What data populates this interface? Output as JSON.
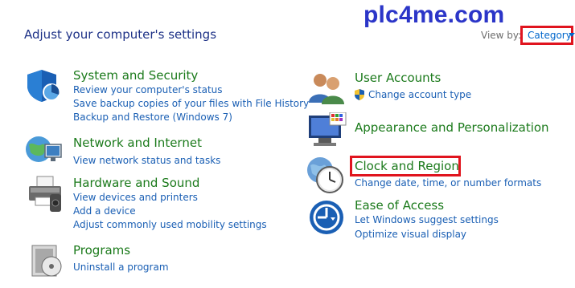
{
  "header": {
    "title": "Adjust your computer's settings",
    "watermark": "plc4me.com",
    "view_by_label": "View by:",
    "view_by_value": "Category"
  },
  "left_column": [
    {
      "title": "System and Security",
      "icon": "shield-icon",
      "links": [
        "Review your computer's status",
        "Save backup copies of your files with File History",
        "Backup and Restore (Windows 7)"
      ]
    },
    {
      "title": "Network and Internet",
      "icon": "globe-network-icon",
      "links": [
        "View network status and tasks"
      ]
    },
    {
      "title": "Hardware and Sound",
      "icon": "printer-icon",
      "links": [
        "View devices and printers",
        "Add a device",
        "Adjust commonly used mobility settings"
      ]
    },
    {
      "title": "Programs",
      "icon": "programs-disc-icon",
      "links": [
        "Uninstall a program"
      ]
    }
  ],
  "right_column": [
    {
      "title": "User Accounts",
      "icon": "users-icon",
      "links": [
        "Change account type"
      ],
      "link_icon": "uac-shield-icon"
    },
    {
      "title": "Appearance and Personalization",
      "icon": "monitor-palette-icon",
      "links": []
    },
    {
      "title": "Clock and Region",
      "icon": "clock-globe-icon",
      "links": [
        "Change date, time, or number formats"
      ]
    },
    {
      "title": "Ease of Access",
      "icon": "ease-of-access-icon",
      "links": [
        "Let Windows suggest settings",
        "Optimize visual display"
      ]
    }
  ],
  "colors": {
    "title_green": "#1b7a1b",
    "link_blue": "#1a5fb4",
    "highlight_red": "#e0141e",
    "watermark_blue": "#2b35c8"
  }
}
